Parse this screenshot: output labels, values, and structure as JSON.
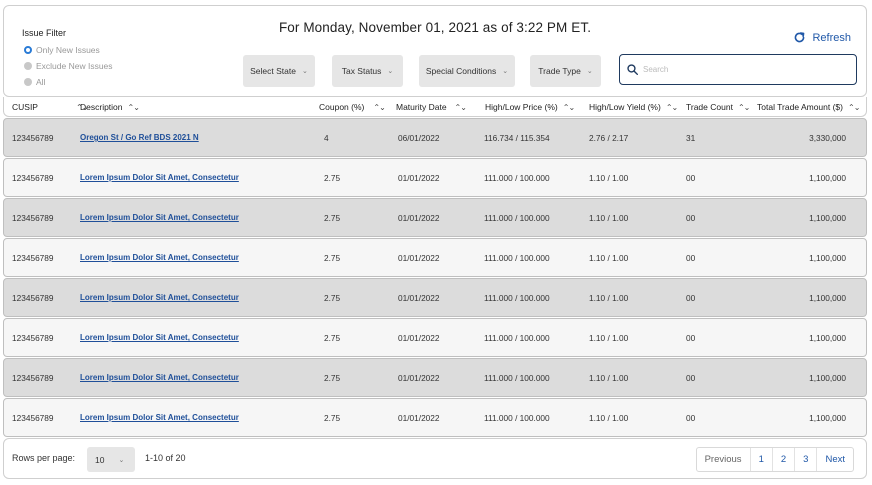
{
  "filter": {
    "title": "Issue Filter",
    "options": [
      {
        "label": "Only New Issues",
        "selected": true
      },
      {
        "label": "Exclude New Issues",
        "selected": false
      },
      {
        "label": "All",
        "selected": false
      }
    ]
  },
  "header": {
    "headline": "For Monday, November 01, 2021 as of 3:22 PM ET.",
    "refresh_label": "Refresh"
  },
  "dropdowns": {
    "state": "Select State",
    "tax": "Tax Status",
    "special": "Special Conditions",
    "trade_type": "Trade Type"
  },
  "search": {
    "placeholder": "Search",
    "icon": "search-icon"
  },
  "table": {
    "columns": {
      "cusip": "CUSIP",
      "description": "Description",
      "coupon": "Coupon (%)",
      "maturity": "Maturity Date",
      "price": "High/Low Price (%)",
      "yield": "High/Low Yield (%)",
      "count": "Trade Count",
      "amount": "Total Trade Amount ($)"
    },
    "rows": [
      {
        "cusip": "123456789",
        "description": "Oregon St / Go Ref BDS 2021 N",
        "coupon": "4",
        "maturity": "06/01/2022",
        "price": "116.734 / 115.354",
        "yield": "2.76 / 2.17",
        "count": "31",
        "amount": "3,330,000"
      },
      {
        "cusip": "123456789",
        "description": "Lorem Ipsum Dolor Sit Amet, Consectetur",
        "coupon": "2.75",
        "maturity": "01/01/2022",
        "price": "111.000 / 100.000",
        "yield": "1.10 / 1.00",
        "count": "00",
        "amount": "1,100,000"
      },
      {
        "cusip": "123456789",
        "description": "Lorem Ipsum Dolor Sit Amet, Consectetur",
        "coupon": "2.75",
        "maturity": "01/01/2022",
        "price": "111.000 / 100.000",
        "yield": "1.10 / 1.00",
        "count": "00",
        "amount": "1,100,000"
      },
      {
        "cusip": "123456789",
        "description": "Lorem Ipsum Dolor Sit Amet, Consectetur",
        "coupon": "2.75",
        "maturity": "01/01/2022",
        "price": "111.000 / 100.000",
        "yield": "1.10 / 1.00",
        "count": "00",
        "amount": "1,100,000"
      },
      {
        "cusip": "123456789",
        "description": "Lorem Ipsum Dolor Sit Amet, Consectetur",
        "coupon": "2.75",
        "maturity": "01/01/2022",
        "price": "111.000 / 100.000",
        "yield": "1.10 / 1.00",
        "count": "00",
        "amount": "1,100,000"
      },
      {
        "cusip": "123456789",
        "description": "Lorem Ipsum Dolor Sit Amet, Consectetur",
        "coupon": "2.75",
        "maturity": "01/01/2022",
        "price": "111.000 / 100.000",
        "yield": "1.10 / 1.00",
        "count": "00",
        "amount": "1,100,000"
      },
      {
        "cusip": "123456789",
        "description": "Lorem Ipsum Dolor Sit Amet, Consectetur",
        "coupon": "2.75",
        "maturity": "01/01/2022",
        "price": "111.000 / 100.000",
        "yield": "1.10 / 1.00",
        "count": "00",
        "amount": "1,100,000"
      },
      {
        "cusip": "123456789",
        "description": "Lorem Ipsum Dolor Sit Amet, Consectetur",
        "coupon": "2.75",
        "maturity": "01/01/2022",
        "price": "111.000 / 100.000",
        "yield": "1.10 / 1.00",
        "count": "00",
        "amount": "1,100,000"
      }
    ]
  },
  "footer": {
    "rows_per_page_label": "Rows per page:",
    "rows_per_page_value": "10",
    "range": "1-10 of 20",
    "previous": "Previous",
    "pages": [
      "1",
      "2",
      "3"
    ],
    "next": "Next"
  },
  "colors": {
    "accent": "#2058a8",
    "link": "#1f4f99",
    "row_shade": "#dcdcdc"
  }
}
